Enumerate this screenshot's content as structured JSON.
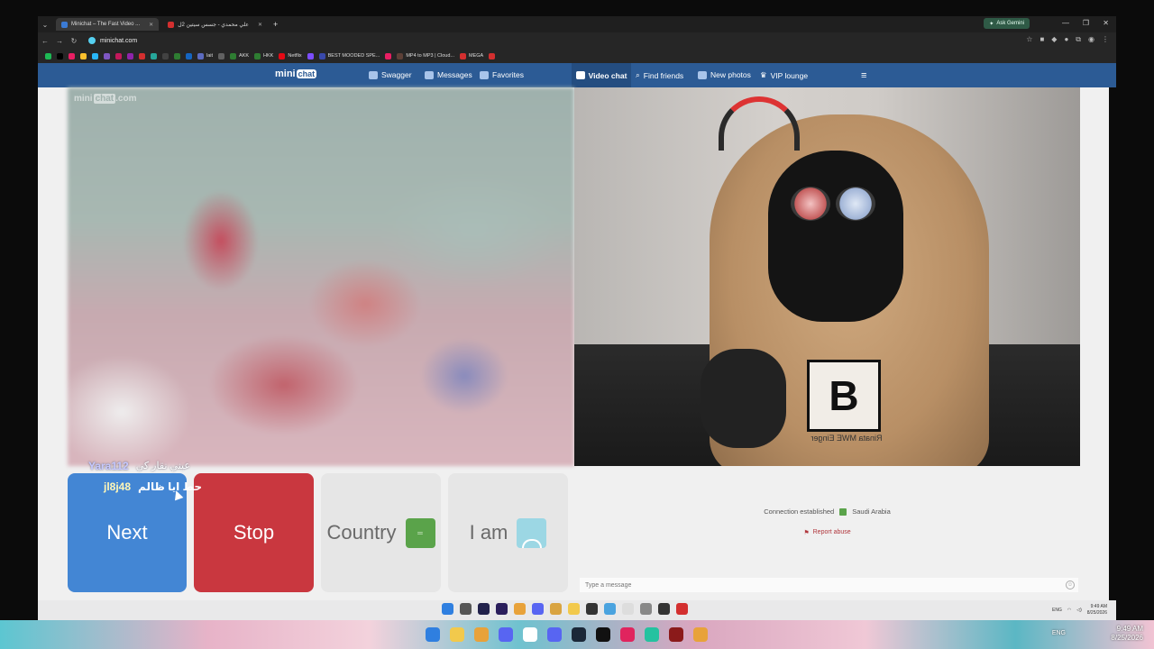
{
  "browser": {
    "tabs": [
      {
        "label": "Minichat – The Fast Video ...",
        "active": true,
        "favicon_color": "#3b7bd4"
      },
      {
        "label": "علي محمدي - جسس سيتين 2ل",
        "active": false,
        "favicon_color": "#d32f2f"
      }
    ],
    "new_tab": "+",
    "ask_gemini": "Ask Gemini",
    "url": "minichat.com",
    "bookmarks": [
      {
        "label": "",
        "color": "#1db954"
      },
      {
        "label": "",
        "color": "#000000"
      },
      {
        "label": "",
        "color": "#e91e63"
      },
      {
        "label": "",
        "color": "#fbc02d"
      },
      {
        "label": "",
        "color": "#29b6f6"
      },
      {
        "label": "",
        "color": "#7e57c2"
      },
      {
        "label": "",
        "color": "#c2185b"
      },
      {
        "label": "",
        "color": "#8e24aa"
      },
      {
        "label": "",
        "color": "#d32f2f"
      },
      {
        "label": "",
        "color": "#26a69a"
      },
      {
        "label": "",
        "color": "#424242"
      },
      {
        "label": "",
        "color": "#2e7d32"
      },
      {
        "label": "",
        "color": "#1565c0"
      },
      {
        "label": "lait",
        "color": "#5c6bc0"
      },
      {
        "label": "",
        "color": "#616161"
      },
      {
        "label": "AKK",
        "color": "#2e7d32"
      },
      {
        "label": "HKK",
        "color": "#2e7d32"
      },
      {
        "label": "Netflix",
        "color": "#e50914"
      },
      {
        "label": "",
        "color": "#7c4dff"
      },
      {
        "label": "BEST MOODED SPE...",
        "color": "#3949ab"
      },
      {
        "label": "",
        "color": "#e91e63"
      },
      {
        "label": "MP4 to MP3 | Cloud...",
        "color": "#5d4037"
      },
      {
        "label": "MEGA",
        "color": "#d32f2f"
      },
      {
        "label": "",
        "color": "#d32f2f"
      }
    ]
  },
  "site": {
    "logo_left": "mini",
    "logo_right": "chat",
    "watermark_left": "mini",
    "watermark_right": "chat",
    "watermark_suffix": ".com",
    "nav": {
      "swagger": "Swagger",
      "messages": "Messages",
      "favorites": "Favorites",
      "video_chat": "Video chat",
      "find_friends": "Find friends",
      "new_photos": "New photos",
      "vip_lounge": "VIP lounge"
    },
    "accent_color": "#2c5b95"
  },
  "controls": {
    "next": "Next",
    "stop": "Stop",
    "country": "Country",
    "country_flag_text": "",
    "i_am": "I am"
  },
  "overlays": {
    "line1_name": "Yara112",
    "line1_text": "عيني نقار كي",
    "line2_name": "jl8j48",
    "line2_text": "حط ايا ظالم"
  },
  "chat": {
    "status": "Connection established",
    "country": "Saudi Arabia",
    "report": "Report abuse",
    "input_placeholder": "Type a message"
  },
  "inner_taskbar": {
    "time": "9:49 AM",
    "date": "8/25/2026",
    "lang": "ENG"
  },
  "host_taskbar": {
    "time": "9:49 AM",
    "date": "8/25/2026",
    "lang": "ENG"
  },
  "webcam_shirt_text": "Rinata MWE Einger"
}
